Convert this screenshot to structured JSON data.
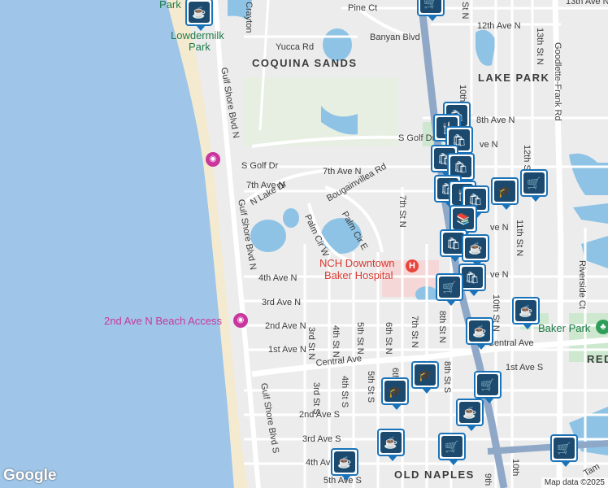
{
  "map": {
    "neighborhoods": [
      "COQUINA SANDS",
      "LAKE PARK",
      "OLD NAPLES",
      "RED"
    ],
    "places": {
      "lowdermilk_1": "Lowdermilk",
      "lowdermilk_2": "Park",
      "park_top": "Park",
      "hospital_1": "NCH Downtown",
      "hospital_2": "Baker Hospital",
      "beach_access": "2nd Ave N Beach Access",
      "baker_park": "Baker Park"
    },
    "streets": {
      "pine_ct": "Pine Ct",
      "banyan": "Banyan Blvd",
      "yucca": "Yucca Rd",
      "crayton": "Crayton",
      "gulf_shore_1": "Gulf Shore Blvd N",
      "gulf_shore_2": "Gulf Shore Blvd N",
      "gulf_shore_3": "Gulf Shore Blvd S",
      "s_golf_dr_1": "S Golf Dr",
      "s_golf_dr_2": "S Golf Dr",
      "seventh_ave_1": "7th Ave N",
      "seventh_ave_2": "7th Ave N",
      "n_lake_dr": "N Lake Dr",
      "bougainvillea": "Bougainvillea Rd",
      "palm_cir_e": "Palm Cir E",
      "palm_cir_w": "Palm Cir W",
      "fourth_ave_n": "4th Ave N",
      "third_ave_n": "3rd Ave N",
      "second_ave_n": "2nd Ave N",
      "first_ave_n": "1st Ave N",
      "central_ave_1": "Central Ave",
      "central_ave_2": "Central Ave",
      "first_ave_s": "1st Ave S",
      "second_ave_s": "2nd Ave S",
      "third_ave_s": "3rd Ave S",
      "fourth_ave_s": "4th Ave S",
      "fifth_ave_s": "5th Ave S",
      "eighth_ave_n": "8th Ave N",
      "twelfth_ave_n": "12th Ave N",
      "thirteenth_ave_n": "13th Ave N",
      "third_st_n": "3rd St N",
      "fourth_st_n": "4th St N",
      "fifth_st_n": "5th St N",
      "sixth_st_n": "6th St N",
      "seventh_st_n": "7th St N",
      "seventh_st_n_2": "7th St N",
      "eighth_st_n": "8th St N",
      "tenth_st_n": "10th St N",
      "tenth_st_n_2": "10th St N",
      "eleventh_st_n": "11th St N",
      "twelfth_st_n": "12th St N",
      "thirteenth_st_n": "13th St N",
      "third_st_s": "3rd St S",
      "fourth_st_s": "4th St S",
      "fifth_st_s": "5th St S",
      "eighth_st_s": "8th St S",
      "sixth_st": "6th",
      "goodlette": "Goodlette-Frank Rd",
      "riverside": "Riverside Ct",
      "ave_n_1": "ve N",
      "ave_n_2": "ve N",
      "ave_n_3": "ve N",
      "tenth": "10th",
      "ninth": "9th",
      "tam": "Tam",
      "st_n_top": "St N",
      "tenth_top": "10th"
    },
    "attribution": "Map data ©2025",
    "google": "Google"
  },
  "pins": [
    {
      "id": "coffee",
      "glyph": "☕"
    },
    {
      "id": "shop",
      "glyph": "🛍"
    },
    {
      "id": "dining",
      "glyph": "🍴"
    },
    {
      "id": "cart",
      "glyph": "🛒"
    },
    {
      "id": "school",
      "glyph": "🎓"
    },
    {
      "id": "library",
      "glyph": "📚"
    }
  ],
  "colors": {
    "water": "#9fc5e8",
    "sand": "#f2e6c6",
    "park": "#cde8cf",
    "road": "#ffffff",
    "highway": "#8fa8c8",
    "pin_border": "#1a73b8",
    "pin_fill": "#1b4a6e",
    "hospital": "#e8453c"
  }
}
